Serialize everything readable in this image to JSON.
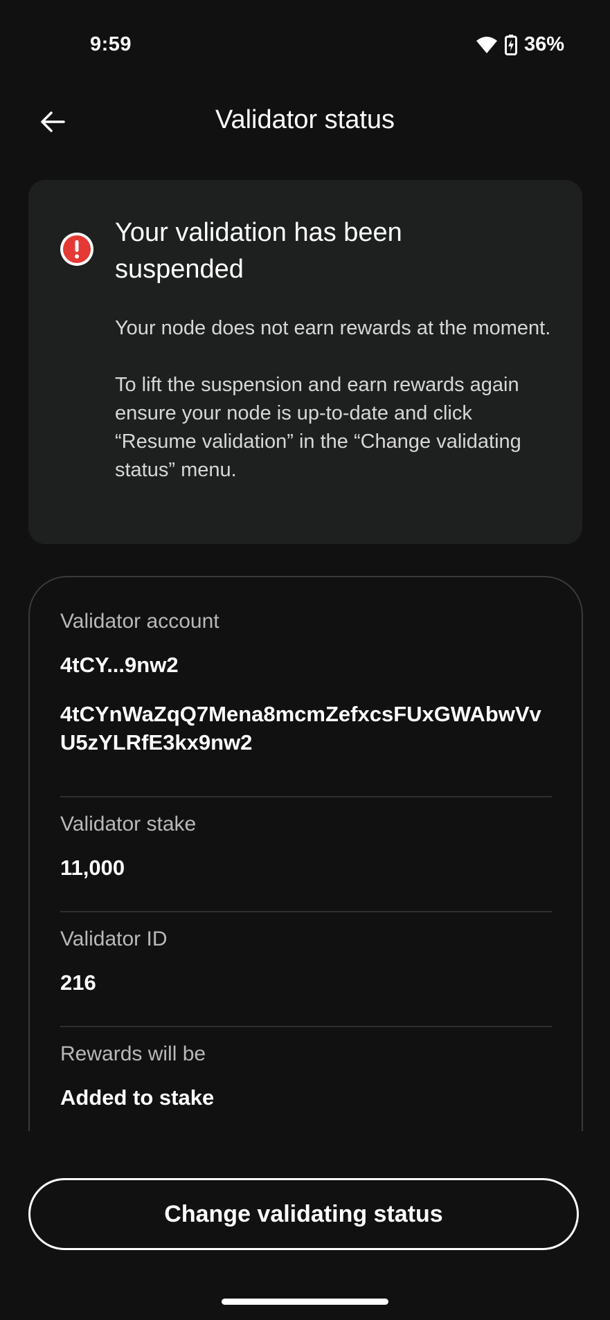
{
  "status_bar": {
    "time": "9:59",
    "battery": "36%",
    "icons": [
      "wifi-icon",
      "battery-charging-icon"
    ]
  },
  "header": {
    "back_icon": "arrow-left-icon",
    "title": "Validator status"
  },
  "alert": {
    "icon": "alert-circle-icon",
    "icon_color": "#e53935",
    "title": "Your validation has been suspended",
    "paragraph_1": "Your node does not earn rewards at the moment.",
    "paragraph_2": "To lift the suspension and earn rewards again ensure your node is up-to-date and click “Resume validation” in the “Change validating status” menu."
  },
  "details": {
    "account": {
      "label": "Validator account",
      "short": "4tCY...9nw2",
      "full": "4tCYnWaZqQ7Mena8mcmZefxcsFUxGWAbwVvU5zYLRfE3kx9nw2"
    },
    "stake": {
      "label": "Validator stake",
      "value": "11,000"
    },
    "id": {
      "label": "Validator ID",
      "value": "216"
    },
    "rewards": {
      "label": "Rewards will be",
      "value": "Added to stake"
    }
  },
  "actions": {
    "change_status_label": "Change validating status"
  },
  "colors": {
    "background": "#111111",
    "card": "#1e1f1f",
    "alert": "#e53935"
  }
}
